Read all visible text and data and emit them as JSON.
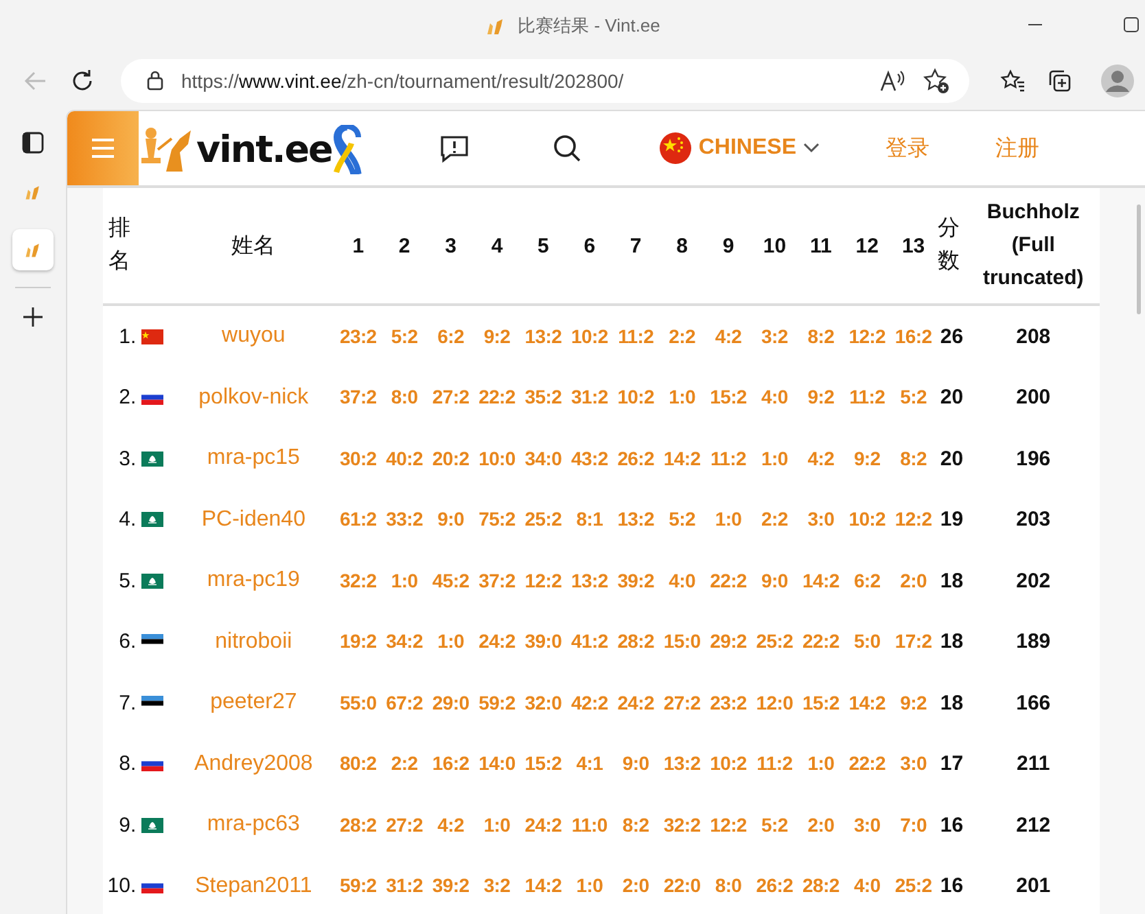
{
  "window": {
    "title": "比赛结果 - Vint.ee"
  },
  "browser": {
    "url": "https://**www.vint.ee**/zh-cn/tournament/result/202800/"
  },
  "sidebar": {
    "tabs": [
      {
        "selected": false
      },
      {
        "selected": true
      }
    ]
  },
  "site_header": {
    "logo": "vint.ee",
    "language": "CHINESE",
    "login": "登录",
    "register": "注册"
  },
  "table": {
    "columns": {
      "rank": "排名",
      "name": "姓名",
      "rounds": [
        "1",
        "2",
        "3",
        "4",
        "5",
        "6",
        "7",
        "8",
        "9",
        "10",
        "11",
        "12",
        "13"
      ],
      "score": "分数",
      "buchholz": "Buchholz (Full truncated)"
    },
    "rows": [
      {
        "rank": "1.",
        "kind": "cn",
        "name": "wuyou",
        "results": [
          "23:2",
          "5:2",
          "6:2",
          "9:2",
          "13:2",
          "10:2",
          "11:2",
          "2:2",
          "4:2",
          "3:2",
          "8:2",
          "12:2",
          "16:2"
        ],
        "score": "26",
        "buchholz": "208"
      },
      {
        "rank": "2.",
        "kind": "ru",
        "name": "polkov-nick",
        "results": [
          "37:2",
          "8:0",
          "27:2",
          "22:2",
          "35:2",
          "31:2",
          "10:2",
          "1:0",
          "15:2",
          "4:0",
          "9:2",
          "11:2",
          "5:2"
        ],
        "score": "20",
        "buchholz": "200"
      },
      {
        "rank": "3.",
        "kind": "mo",
        "name": "mra-pc15",
        "results": [
          "30:2",
          "40:2",
          "20:2",
          "10:0",
          "34:0",
          "43:2",
          "26:2",
          "14:2",
          "11:2",
          "1:0",
          "4:2",
          "9:2",
          "8:2"
        ],
        "score": "20",
        "buchholz": "196"
      },
      {
        "rank": "4.",
        "kind": "mo",
        "name": "PC-iden40",
        "results": [
          "61:2",
          "33:2",
          "9:0",
          "75:2",
          "25:2",
          "8:1",
          "13:2",
          "5:2",
          "1:0",
          "2:2",
          "3:0",
          "10:2",
          "12:2"
        ],
        "score": "19",
        "buchholz": "203"
      },
      {
        "rank": "5.",
        "kind": "mo",
        "name": "mra-pc19",
        "results": [
          "32:2",
          "1:0",
          "45:2",
          "37:2",
          "12:2",
          "13:2",
          "39:2",
          "4:0",
          "22:2",
          "9:0",
          "14:2",
          "6:2",
          "2:0"
        ],
        "score": "18",
        "buchholz": "202"
      },
      {
        "rank": "6.",
        "kind": "ee",
        "name": "nitroboii",
        "results": [
          "19:2",
          "34:2",
          "1:0",
          "24:2",
          "39:0",
          "41:2",
          "28:2",
          "15:0",
          "29:2",
          "25:2",
          "22:2",
          "5:0",
          "17:2"
        ],
        "score": "18",
        "buchholz": "189"
      },
      {
        "rank": "7.",
        "kind": "ee",
        "name": "peeter27",
        "results": [
          "55:0",
          "67:2",
          "29:0",
          "59:2",
          "32:0",
          "42:2",
          "24:2",
          "27:2",
          "23:2",
          "12:0",
          "15:2",
          "14:2",
          "9:2"
        ],
        "score": "18",
        "buchholz": "166"
      },
      {
        "rank": "8.",
        "kind": "ru",
        "name": "Andrey2008",
        "results": [
          "80:2",
          "2:2",
          "16:2",
          "14:0",
          "15:2",
          "4:1",
          "9:0",
          "13:2",
          "10:2",
          "11:2",
          "1:0",
          "22:2",
          "3:0"
        ],
        "score": "17",
        "buchholz": "211"
      },
      {
        "rank": "9.",
        "kind": "mo",
        "name": "mra-pc63",
        "results": [
          "28:2",
          "27:2",
          "4:2",
          "1:0",
          "24:2",
          "11:0",
          "8:2",
          "32:2",
          "12:2",
          "5:2",
          "2:0",
          "3:0",
          "7:0"
        ],
        "score": "16",
        "buchholz": "212"
      },
      {
        "rank": "10.",
        "kind": "ru",
        "name": "Stepan2011",
        "results": [
          "59:2",
          "31:2",
          "39:2",
          "3:2",
          "14:2",
          "1:0",
          "2:0",
          "22:0",
          "8:0",
          "26:2",
          "28:2",
          "4:0",
          "25:2"
        ],
        "score": "16",
        "buchholz": "201"
      }
    ]
  }
}
